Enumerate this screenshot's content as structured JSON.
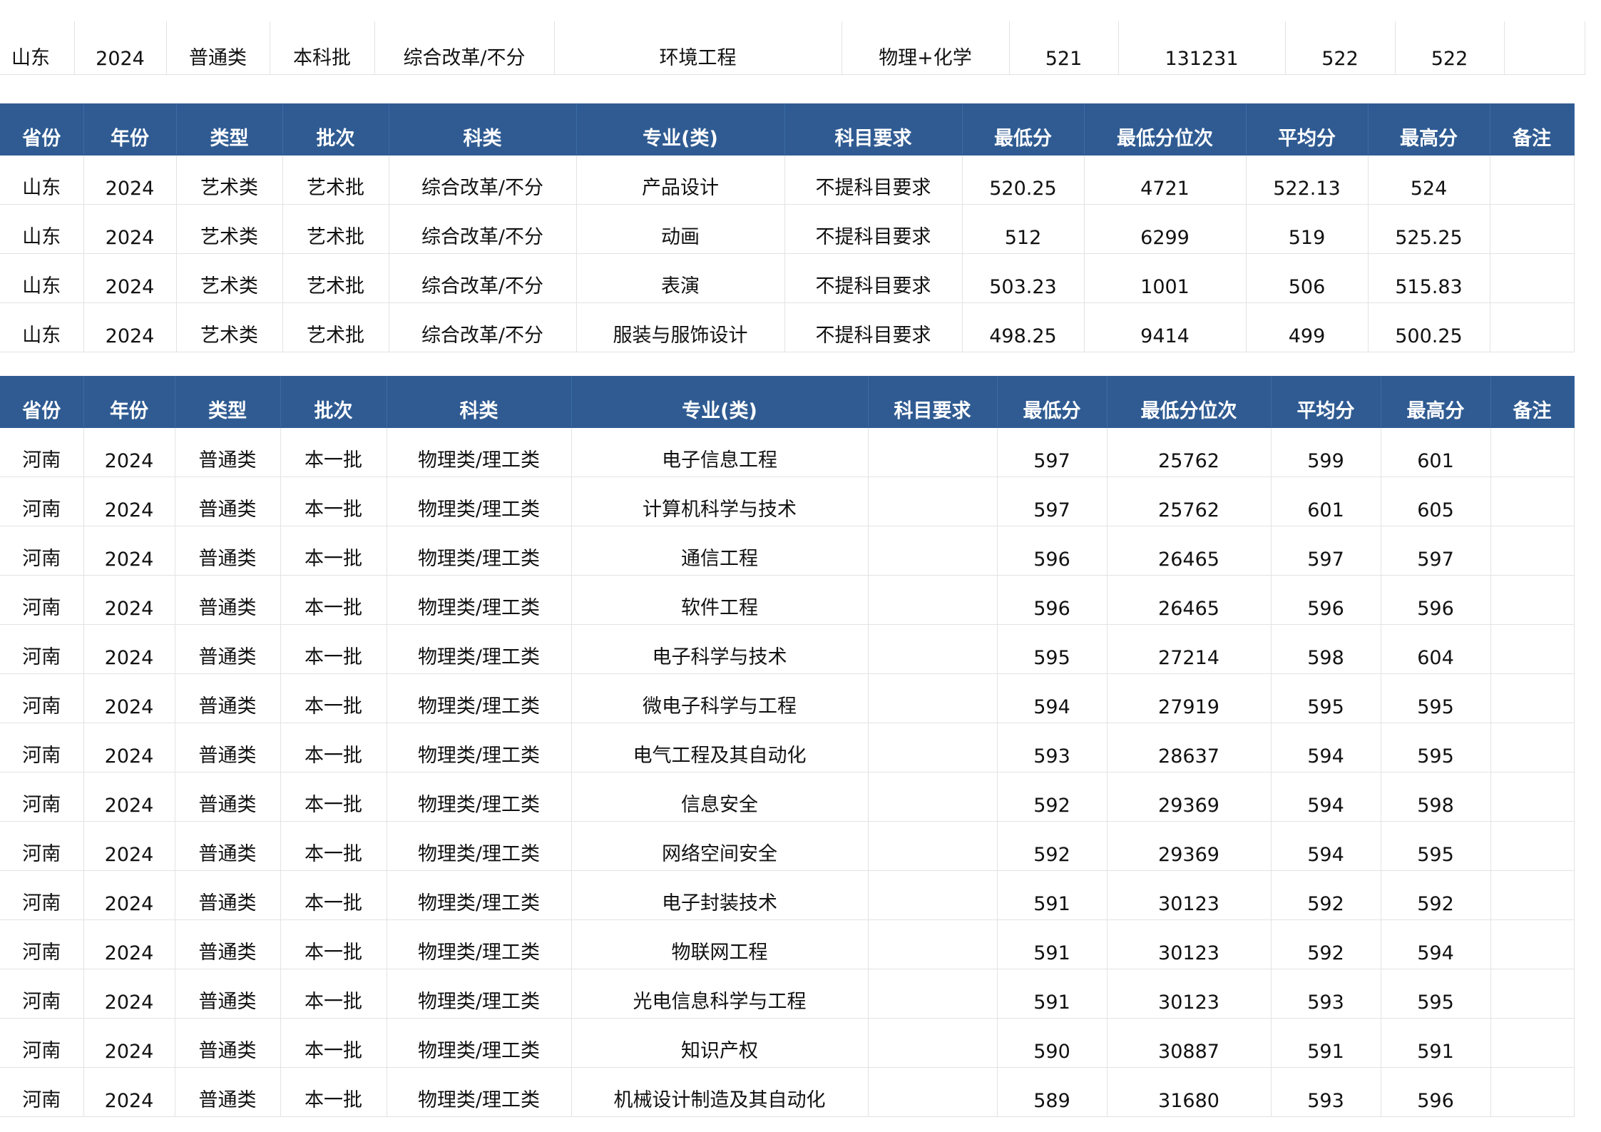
{
  "top_row": [
    "山东",
    "2024",
    "普通类",
    "本科批",
    "综合改革/不分",
    "环境工程",
    "物理+化学",
    "521",
    "131231",
    "522",
    "522",
    ""
  ],
  "art_table": {
    "headers": [
      "省份",
      "年份",
      "类型",
      "批次",
      "科类",
      "专业(类)",
      "科目要求",
      "最低分",
      "最低分位次",
      "平均分",
      "最高分",
      "备注"
    ],
    "rows": [
      [
        "山东",
        "2024",
        "艺术类",
        "艺术批",
        "综合改革/不分",
        "产品设计",
        "不提科目要求",
        "520.25",
        "4721",
        "522.13",
        "524",
        ""
      ],
      [
        "山东",
        "2024",
        "艺术类",
        "艺术批",
        "综合改革/不分",
        "动画",
        "不提科目要求",
        "512",
        "6299",
        "519",
        "525.25",
        ""
      ],
      [
        "山东",
        "2024",
        "艺术类",
        "艺术批",
        "综合改革/不分",
        "表演",
        "不提科目要求",
        "503.23",
        "1001",
        "506",
        "515.83",
        ""
      ],
      [
        "山东",
        "2024",
        "艺术类",
        "艺术批",
        "综合改革/不分",
        "服装与服饰设计",
        "不提科目要求",
        "498.25",
        "9414",
        "499",
        "500.25",
        ""
      ]
    ]
  },
  "henan_table": {
    "headers": [
      "省份",
      "年份",
      "类型",
      "批次",
      "科类",
      "专业(类)",
      "科目要求",
      "最低分",
      "最低分位次",
      "平均分",
      "最高分",
      "备注"
    ],
    "rows": [
      [
        "河南",
        "2024",
        "普通类",
        "本一批",
        "物理类/理工类",
        "电子信息工程",
        "",
        "597",
        "25762",
        "599",
        "601",
        ""
      ],
      [
        "河南",
        "2024",
        "普通类",
        "本一批",
        "物理类/理工类",
        "计算机科学与技术",
        "",
        "597",
        "25762",
        "601",
        "605",
        ""
      ],
      [
        "河南",
        "2024",
        "普通类",
        "本一批",
        "物理类/理工类",
        "通信工程",
        "",
        "596",
        "26465",
        "597",
        "597",
        ""
      ],
      [
        "河南",
        "2024",
        "普通类",
        "本一批",
        "物理类/理工类",
        "软件工程",
        "",
        "596",
        "26465",
        "596",
        "596",
        ""
      ],
      [
        "河南",
        "2024",
        "普通类",
        "本一批",
        "物理类/理工类",
        "电子科学与技术",
        "",
        "595",
        "27214",
        "598",
        "604",
        ""
      ],
      [
        "河南",
        "2024",
        "普通类",
        "本一批",
        "物理类/理工类",
        "微电子科学与工程",
        "",
        "594",
        "27919",
        "595",
        "595",
        ""
      ],
      [
        "河南",
        "2024",
        "普通类",
        "本一批",
        "物理类/理工类",
        "电气工程及其自动化",
        "",
        "593",
        "28637",
        "594",
        "595",
        ""
      ],
      [
        "河南",
        "2024",
        "普通类",
        "本一批",
        "物理类/理工类",
        "信息安全",
        "",
        "592",
        "29369",
        "594",
        "598",
        ""
      ],
      [
        "河南",
        "2024",
        "普通类",
        "本一批",
        "物理类/理工类",
        "网络空间安全",
        "",
        "592",
        "29369",
        "594",
        "595",
        ""
      ],
      [
        "河南",
        "2024",
        "普通类",
        "本一批",
        "物理类/理工类",
        "电子封装技术",
        "",
        "591",
        "30123",
        "592",
        "592",
        ""
      ],
      [
        "河南",
        "2024",
        "普通类",
        "本一批",
        "物理类/理工类",
        "物联网工程",
        "",
        "591",
        "30123",
        "592",
        "594",
        ""
      ],
      [
        "河南",
        "2024",
        "普通类",
        "本一批",
        "物理类/理工类",
        "光电信息科学与工程",
        "",
        "591",
        "30123",
        "593",
        "595",
        ""
      ],
      [
        "河南",
        "2024",
        "普通类",
        "本一批",
        "物理类/理工类",
        "知识产权",
        "",
        "590",
        "30887",
        "591",
        "591",
        ""
      ],
      [
        "河南",
        "2024",
        "普通类",
        "本一批",
        "物理类/理工类",
        "机械设计制造及其自动化",
        "",
        "589",
        "31680",
        "593",
        "596",
        ""
      ]
    ]
  }
}
